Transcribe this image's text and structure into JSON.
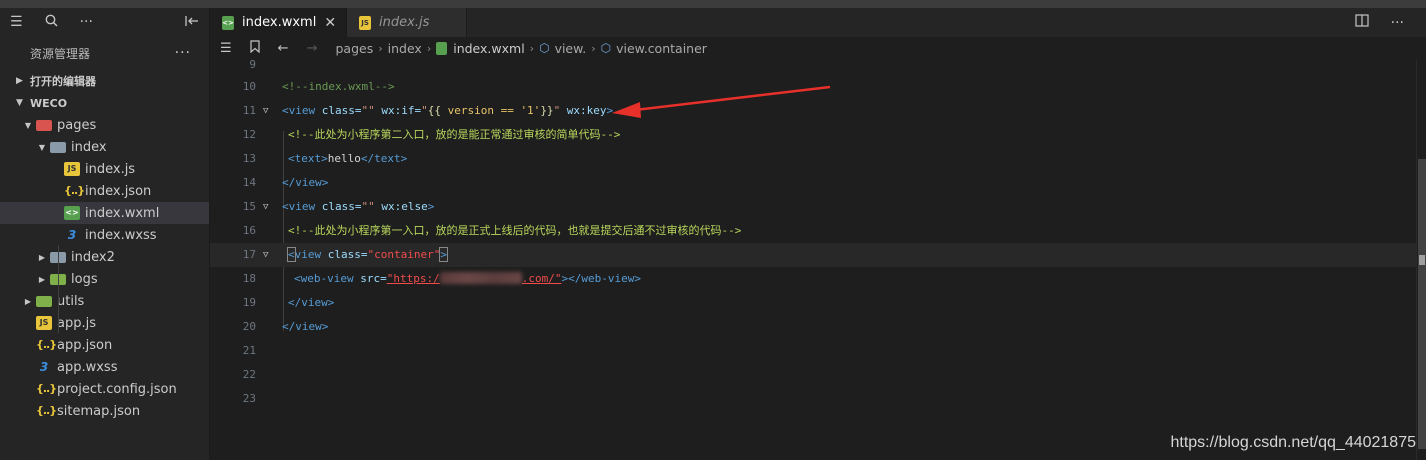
{
  "sidebar": {
    "title": "资源管理器",
    "more": "···",
    "sections": {
      "open_editors": "打开的编辑器",
      "project": "WECO"
    },
    "tree": [
      {
        "label": "pages",
        "kind": "folder-pages",
        "depth": 1,
        "expanded": true
      },
      {
        "label": "index",
        "kind": "folder",
        "depth": 2,
        "expanded": true
      },
      {
        "label": "index.js",
        "kind": "js",
        "depth": 3
      },
      {
        "label": "index.json",
        "kind": "json",
        "depth": 3
      },
      {
        "label": "index.wxml",
        "kind": "wxml",
        "depth": 3,
        "selected": true
      },
      {
        "label": "index.wxss",
        "kind": "wxss",
        "depth": 3
      },
      {
        "label": "index2",
        "kind": "folder",
        "depth": 2,
        "expanded": false
      },
      {
        "label": "logs",
        "kind": "folder-green",
        "depth": 2,
        "expanded": false
      },
      {
        "label": "utils",
        "kind": "folder-green",
        "depth": 1,
        "expanded": false
      },
      {
        "label": "app.js",
        "kind": "js",
        "depth": 1
      },
      {
        "label": "app.json",
        "kind": "json",
        "depth": 1
      },
      {
        "label": "app.wxss",
        "kind": "wxss",
        "depth": 1
      },
      {
        "label": "project.config.json",
        "kind": "json",
        "depth": 1
      },
      {
        "label": "sitemap.json",
        "kind": "json",
        "depth": 1
      }
    ]
  },
  "icons": {
    "js": "JS",
    "json": "{..}",
    "wxml": "<>",
    "wxss": "3"
  },
  "tabs": [
    {
      "label": "index.wxml",
      "active": true,
      "close": "✕"
    },
    {
      "label": "index.js",
      "active": false
    }
  ],
  "breadcrumb": [
    "pages",
    "index",
    "index.wxml",
    "view.",
    "view.container"
  ],
  "editor": {
    "lines": [
      {
        "n": "9"
      },
      {
        "n": "10"
      },
      {
        "n": "11"
      },
      {
        "n": "12"
      },
      {
        "n": "13"
      },
      {
        "n": "14"
      },
      {
        "n": "15"
      },
      {
        "n": "16"
      },
      {
        "n": "17"
      },
      {
        "n": "18"
      },
      {
        "n": "19"
      },
      {
        "n": "20"
      },
      {
        "n": "21"
      },
      {
        "n": "22"
      },
      {
        "n": "23"
      }
    ],
    "code": {
      "l10": "<!--index.wxml-->",
      "l11_open": "<view",
      "l11_attr1": " class=",
      "l11_val1": "\"\"",
      "l11_attr2": " wx:if=",
      "l11_q1": "\"",
      "l11_brace_o": "{{",
      "l11_expr": " version == '1'",
      "l11_brace_c": "}}",
      "l11_q2": "\"",
      "l11_attr3": " wx:key",
      "l11_close": ">",
      "l12": "<!--此处为小程序第二入口，放的是能正常通过审核的简单代码-->",
      "l13_open": "<text>",
      "l13_text": "hello",
      "l13_close": "</text>",
      "l14": "</view>",
      "l15_open": "<view",
      "l15_attr1": " class=",
      "l15_val1": "\"\"",
      "l15_attr2": " wx:else",
      "l15_close": ">",
      "l16": "<!--此处为小程序第一入口，放的是正式上线后的代码，也就是提交后通不过审核的代码-->",
      "l17_lt": "<",
      "l17_tag": "view",
      "l17_attr": " class=",
      "l17_val": "\"container\"",
      "l17_gt": ">",
      "l18_open": "<web-view",
      "l18_attr": " src=",
      "l18_val1": "\"https:/",
      "l18_val2": ".com/\"",
      "l18_close": "></web-view>",
      "l19": "</view>",
      "l20": "</view>"
    }
  },
  "watermark": "https://blog.csdn.net/qq_44021875",
  "colors": {
    "background": "#1e1e1e",
    "sidebar": "#252526",
    "selected": "#37373d",
    "arrow": "#e8302a"
  }
}
